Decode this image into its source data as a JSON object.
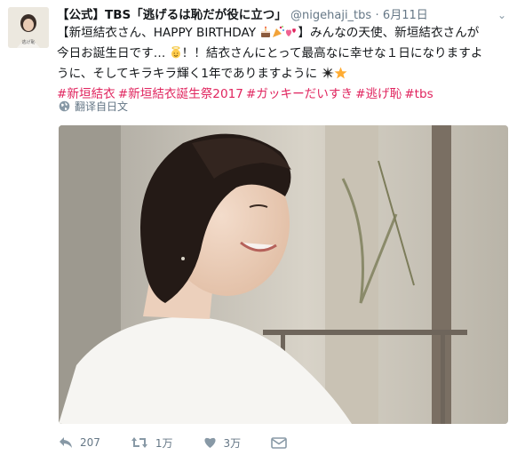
{
  "tweet": {
    "display_name": "【公式】TBS「逃げるは恥だが役に立つ」",
    "handle": "@nigehaji_tbs",
    "separator": "·",
    "date": "6月11日",
    "text_line1": "【新垣結衣さん、HAPPY BIRTHDAY",
    "text_line1b": "】みんなの天使、新垣結衣さんが",
    "text_line2": "今日お誕生日です…",
    "text_line2b": "！！結衣さんにとって最高なに幸せな１日になりますよ",
    "text_line3": "うに、そしてキラキラ輝く1年でありますように",
    "hashtags": [
      "#新垣結衣",
      "#新垣結衣誕生祭2017",
      "#ガッキーだいすき",
      "#逃げ恥",
      "#tbs"
    ],
    "translate_label": "翻译自日文",
    "avatar_caption": "逃げ恥",
    "actions": {
      "reply_count": "207",
      "retweet_count": "1万",
      "like_count": "3万"
    }
  },
  "colors": {
    "hashtag": "#e0245e",
    "meta": "#657786",
    "text": "#14171a"
  },
  "icons": [
    "chevron-down-icon",
    "globe-icon",
    "reply-icon",
    "retweet-icon",
    "heart-icon",
    "dm-icon"
  ]
}
